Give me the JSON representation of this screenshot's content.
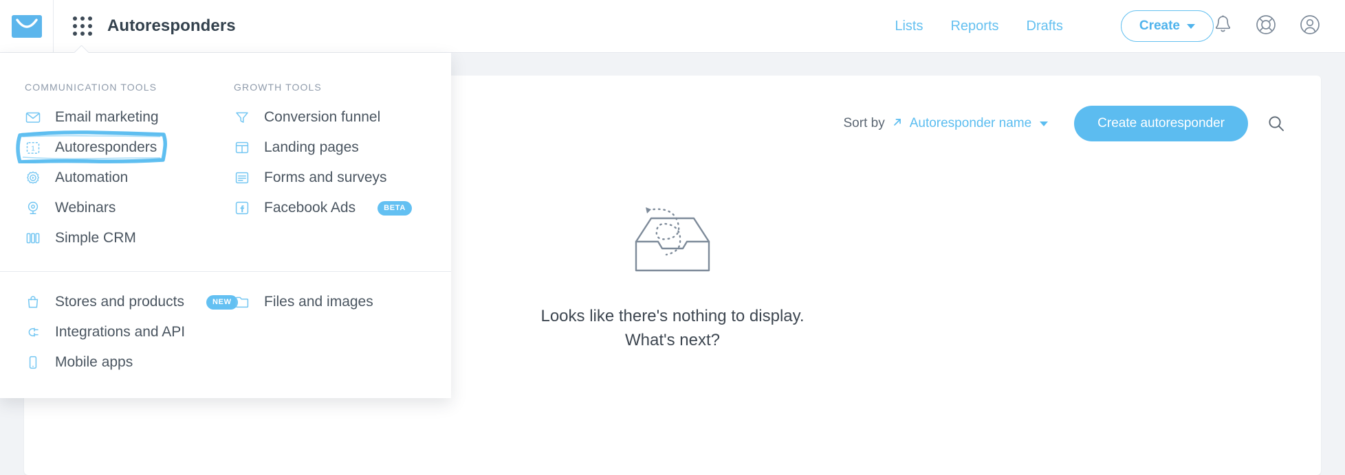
{
  "header": {
    "logo_icon": "envelope-logo-icon",
    "app_switcher_icon": "grid-dots-icon",
    "app_title": "Autoresponders",
    "nav": [
      {
        "label": "Lists",
        "name": "nav-lists"
      },
      {
        "label": "Reports",
        "name": "nav-reports"
      },
      {
        "label": "Drafts",
        "name": "nav-drafts"
      }
    ],
    "create_button": "Create",
    "create_caret_icon": "chevron-down-icon",
    "icons": [
      {
        "name": "bell-icon",
        "title": "Notifications"
      },
      {
        "name": "lifebuoy-icon",
        "title": "Help"
      },
      {
        "name": "user-account-icon",
        "title": "Account"
      }
    ]
  },
  "megamenu": {
    "communication": {
      "heading": "COMMUNICATION TOOLS",
      "items": [
        {
          "label": "Email marketing",
          "icon": "envelope-icon",
          "badge": "",
          "highlighted": false
        },
        {
          "label": "Autoresponders",
          "icon": "calendar-one-icon",
          "badge": "",
          "highlighted": true
        },
        {
          "label": "Automation",
          "icon": "gear-play-icon",
          "badge": "",
          "highlighted": false
        },
        {
          "label": "Webinars",
          "icon": "webcam-icon",
          "badge": "",
          "highlighted": false
        },
        {
          "label": "Simple CRM",
          "icon": "columns-icon",
          "badge": "",
          "highlighted": false
        }
      ]
    },
    "growth": {
      "heading": "GROWTH TOOLS",
      "items": [
        {
          "label": "Conversion funnel",
          "icon": "funnel-icon",
          "badge": ""
        },
        {
          "label": "Landing pages",
          "icon": "layout-icon",
          "badge": ""
        },
        {
          "label": "Forms and surveys",
          "icon": "form-icon",
          "badge": ""
        },
        {
          "label": "Facebook Ads",
          "icon": "facebook-icon",
          "badge": "BETA"
        }
      ]
    },
    "bottom": {
      "left": [
        {
          "label": "Stores and products",
          "icon": "shopping-bag-icon",
          "badge": "NEW"
        },
        {
          "label": "Integrations and API",
          "icon": "plug-icon",
          "badge": ""
        },
        {
          "label": "Mobile apps",
          "icon": "mobile-phone-icon",
          "badge": ""
        }
      ],
      "right": [
        {
          "label": "Files and images",
          "icon": "folder-icon",
          "badge": ""
        }
      ]
    }
  },
  "main": {
    "sort_label": "Sort by",
    "sort_direction_icon": "arrow-up-right-icon",
    "sort_value": "Autoresponder name",
    "sort_caret_icon": "chevron-down-icon",
    "create_autoresponder_button": "Create autoresponder",
    "search_icon": "search-icon",
    "empty_illustration_icon": "empty-tray-icon",
    "empty_line1": "Looks like there's nothing to display.",
    "empty_line2": "What's next?"
  },
  "colors": {
    "brand_blue": "#5cbcf0",
    "link_blue": "#64c0f0",
    "text_dark": "#33414d",
    "text_muted": "#8f9bab",
    "page_bg": "#f1f3f6",
    "highlight_stroke": "#5bbdf0"
  }
}
